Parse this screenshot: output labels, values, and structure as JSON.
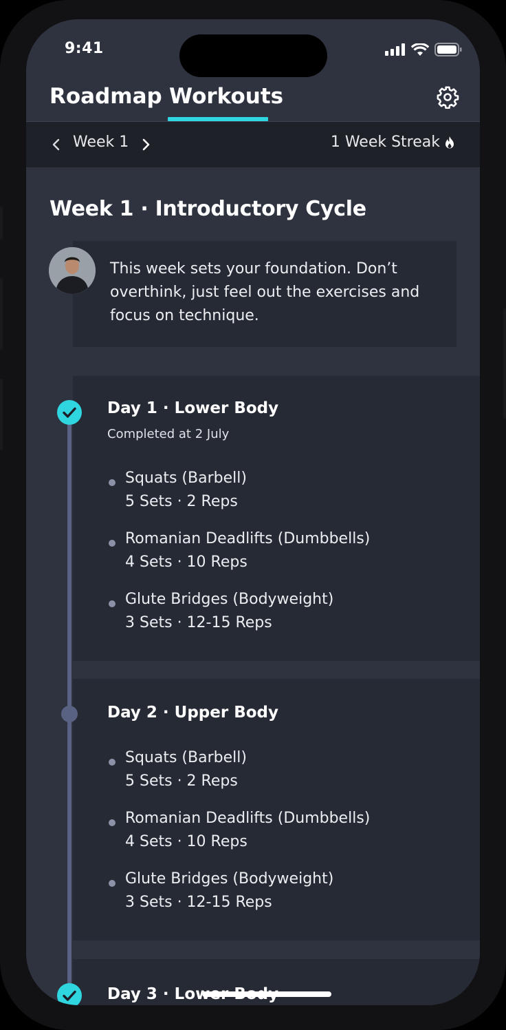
{
  "status_bar": {
    "time": "9:41"
  },
  "tabs": [
    {
      "label": "Roadmap"
    },
    {
      "label": "Workouts"
    }
  ],
  "icons": {
    "settings": "gear-icon",
    "flame": "flame-icon",
    "prev": "chevron-left-icon",
    "next": "chevron-right-icon",
    "check": "check-icon"
  },
  "accent_color": "#2fd6e0",
  "week_nav": {
    "label": "Week 1",
    "streak": "1 Week Streak"
  },
  "main": {
    "title": "Week 1 · Introductory Cycle",
    "coach_message": "This week sets your foundation. Don’t overthink, just feel out the exercises and focus on technique."
  },
  "days": [
    {
      "title": "Day 1 · Lower Body",
      "subtitle": "Completed at 2 July",
      "status": "completed",
      "exercises": [
        {
          "name": "Squats (Barbell)",
          "meta": "5 Sets · 2 Reps"
        },
        {
          "name": "Romanian Deadlifts (Dumbbells)",
          "meta": "4 Sets · 10 Reps"
        },
        {
          "name": "Glute Bridges (Bodyweight)",
          "meta": "3 Sets · 12-15 Reps"
        }
      ]
    },
    {
      "title": "Day 2 · Upper Body",
      "status": "pending",
      "exercises": [
        {
          "name": "Squats (Barbell)",
          "meta": "5 Sets · 2 Reps"
        },
        {
          "name": "Romanian Deadlifts (Dumbbells)",
          "meta": "4 Sets · 10 Reps"
        },
        {
          "name": "Glute Bridges (Bodyweight)",
          "meta": "3 Sets · 12-15 Reps"
        }
      ]
    },
    {
      "title": "Day 3 · Lower Body",
      "status": "completed"
    }
  ]
}
